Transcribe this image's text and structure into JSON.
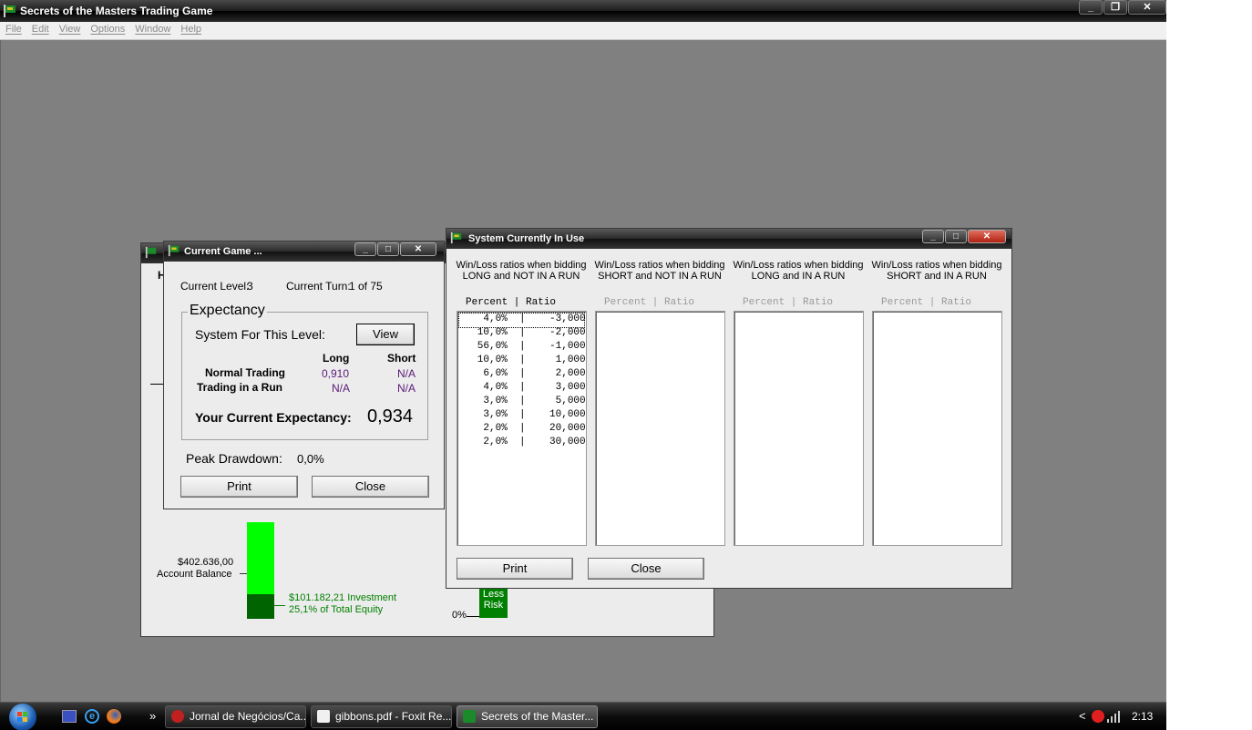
{
  "app": {
    "title": "Secrets of the Masters Trading Game"
  },
  "menu": [
    "File",
    "Edit",
    "View",
    "Options",
    "Window",
    "Help"
  ],
  "back_window": {
    "partial_letter": "H",
    "account_balance_value": "$402.636,00",
    "account_balance_label": "Account Balance",
    "investment_line1": "$101.182,21 Investment",
    "investment_line2": "25,1% of Total Equity",
    "zero_pct": "0%",
    "less_risk": "Less Risk",
    "account_fill_fraction": 0.749
  },
  "current_game": {
    "title": "Current Game ...",
    "current_level_label": "Current Level:",
    "current_level": "3",
    "current_turn_label": "Current Turn:",
    "current_turn": "1 of 75",
    "expectancy_legend": "Expectancy",
    "system_label": "System For This Level:",
    "view_button": "View",
    "col_long": "Long",
    "col_short": "Short",
    "normal_trading_label": "Normal Trading",
    "normal_long": "0,910",
    "normal_short": "N/A",
    "run_label": "Trading in a Run",
    "run_long": "N/A",
    "run_short": "N/A",
    "your_expectancy_label": "Your Current Expectancy:",
    "your_expectancy": "0,934",
    "peak_drawdown_label": "Peak Drawdown:",
    "peak_drawdown": "0,0%",
    "print_button": "Print",
    "close_button": "Close"
  },
  "system": {
    "title": "System Currently In Use",
    "columns": [
      {
        "line1": "Win/Loss ratios when bidding",
        "line2": "LONG and NOT IN A RUN",
        "header": "Percent  |    Ratio"
      },
      {
        "line1": "Win/Loss ratios when bidding",
        "line2": "SHORT and NOT IN A RUN",
        "header": "Percent  |    Ratio"
      },
      {
        "line1": "Win/Loss ratios when bidding",
        "line2": "LONG and IN A RUN",
        "header": "Percent  |    Ratio"
      },
      {
        "line1": "Win/Loss ratios when bidding",
        "line2": "SHORT and IN A RUN",
        "header": "Percent  |    Ratio"
      }
    ],
    "rows": [
      "    4,0%  |    -3,000",
      "   10,0%  |    -2,000",
      "   56,0%  |    -1,000",
      "   10,0%  |     1,000",
      "    6,0%  |     2,000",
      "    4,0%  |     3,000",
      "    3,0%  |     5,000",
      "    3,0%  |    10,000",
      "    2,0%  |    20,000",
      "    2,0%  |    30,000"
    ],
    "print_button": "Print",
    "close_button": "Close"
  },
  "taskbar": {
    "items": [
      "Jornal de Negócios/Ca...",
      "gibbons.pdf - Foxit Re...",
      "Secrets of the Master..."
    ],
    "chevron": "»",
    "tray_chevron": "<",
    "clock": "2:13"
  },
  "colors": {
    "green_bright": "#00ff00",
    "green_dark": "#008000",
    "purple_value": "#5a1a78"
  }
}
